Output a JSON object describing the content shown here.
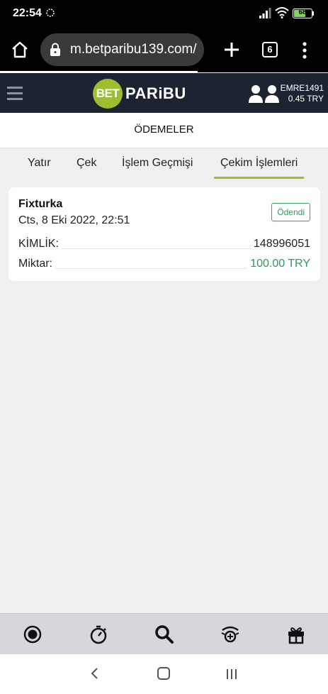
{
  "status_bar": {
    "time": "22:54",
    "battery": "68"
  },
  "browser": {
    "url": "m.betparibu139.com/",
    "tab_count": "6"
  },
  "site_header": {
    "logo_mark": "BET",
    "logo_brand": "PARiBU",
    "username": "EMRE1491",
    "balance": "0.45 TRY"
  },
  "page": {
    "title": "ÖDEMELER"
  },
  "tabs": [
    {
      "label": "Yatır"
    },
    {
      "label": "Çek"
    },
    {
      "label": "İşlem Geçmişi"
    },
    {
      "label": "Çekim İşlemleri",
      "active": true
    }
  ],
  "transaction": {
    "provider": "Fixturka",
    "date": "Cts, 8 Eki 2022, 22:51",
    "status": "Ödendi",
    "id_label": "KİMLİK:",
    "id_value": "148996051",
    "amount_label": "Miktar:",
    "amount_value": "100.00 TRY"
  },
  "bottom_nav": [
    {
      "icon": "live-icon"
    },
    {
      "icon": "stopwatch-icon"
    },
    {
      "icon": "search-icon"
    },
    {
      "icon": "casino-icon"
    },
    {
      "icon": "gift-icon"
    }
  ],
  "colors": {
    "accent": "#9bbf2f",
    "header_bg": "#1d2431",
    "status_paid": "#2e9a5e"
  }
}
